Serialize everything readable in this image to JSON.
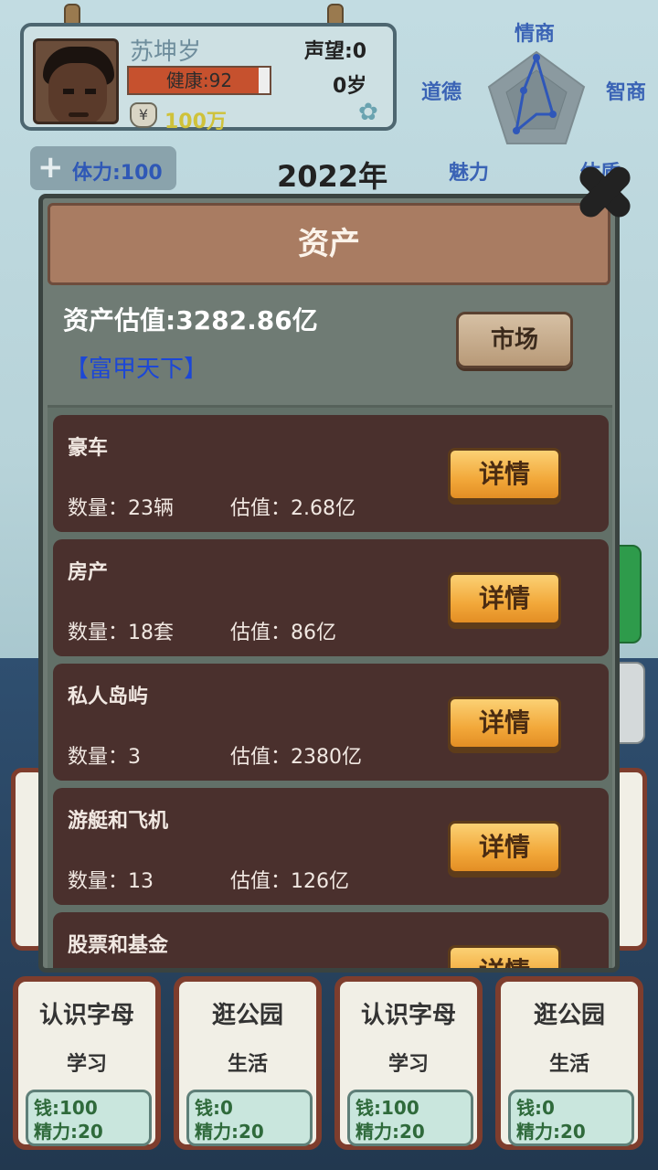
{
  "player": {
    "name": "苏坤岁",
    "health": "健康:92",
    "health_fraction": 0.92,
    "money": "100万",
    "money_symbol": "¥",
    "reputation": "声望:0",
    "age": "0岁"
  },
  "radar": {
    "labels": [
      "情商",
      "智商",
      "道德",
      "魅力",
      "体质"
    ]
  },
  "stamina": {
    "plus": "+",
    "label": "体力:100"
  },
  "year": "2022年",
  "modal": {
    "title": "资产",
    "valuation": "资产估值:3282.86亿",
    "badge": "【富甲天下】",
    "market_button": "市场",
    "assets": [
      {
        "name": "豪车",
        "quantity": "数量：23辆",
        "value": "估值：2.68亿",
        "button": "详情"
      },
      {
        "name": "房产",
        "quantity": "数量：18套",
        "value": "估值：86亿",
        "button": "详情"
      },
      {
        "name": "私人岛屿",
        "quantity": "数量：3",
        "value": "估值：2380亿",
        "button": "详情"
      },
      {
        "name": "游艇和飞机",
        "quantity": "数量：13",
        "value": "估值：126亿",
        "button": "详情"
      },
      {
        "name": "股票和基金",
        "quantity": "",
        "value": "",
        "button": "详情"
      }
    ]
  },
  "bottom_cards": [
    {
      "title": "认识字母",
      "category": "学习",
      "money": "钱:100",
      "energy": "精力:20"
    },
    {
      "title": "逛公园",
      "category": "生活",
      "money": "钱:0",
      "energy": "精力:20"
    },
    {
      "title": "认识字母",
      "category": "学习",
      "money": "钱:100",
      "energy": "精力:20"
    },
    {
      "title": "逛公园",
      "category": "生活",
      "money": "钱:0",
      "energy": "精力:20"
    }
  ],
  "colors": {
    "accent_blue": "#3a63b5",
    "panel_header": "#a97c62",
    "row_bg": "#4a302d",
    "detail_button": "#f2a83a"
  }
}
